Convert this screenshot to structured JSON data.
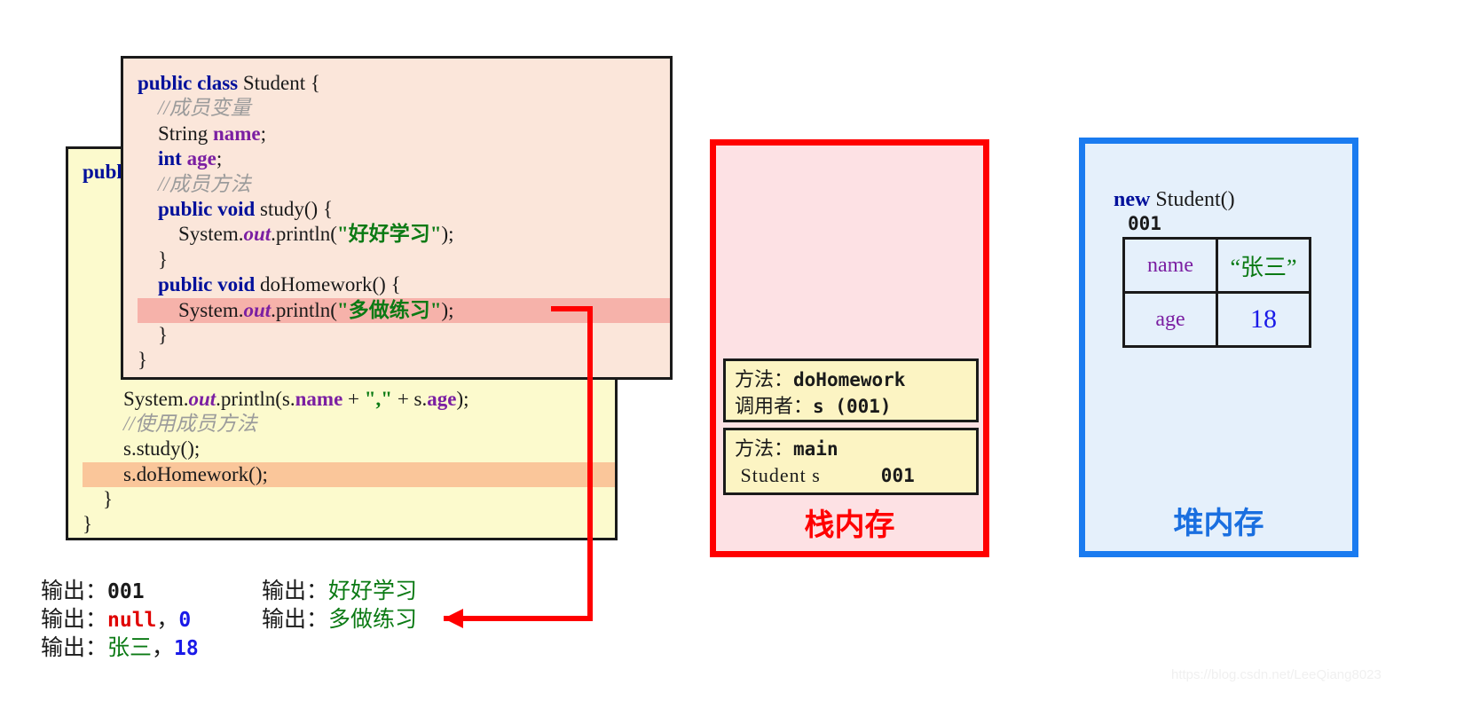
{
  "student_class": {
    "lines": [
      [
        {
          "t": "public ",
          "c": "kw"
        },
        {
          "t": "class ",
          "c": "kw"
        },
        {
          "t": "Student {",
          "c": ""
        }
      ],
      [
        {
          "t": "    //成员变量",
          "c": "cmt"
        }
      ],
      [
        {
          "t": "    String ",
          "c": ""
        },
        {
          "t": "name",
          "c": "field"
        },
        {
          "t": ";",
          "c": ""
        }
      ],
      [
        {
          "t": "    ",
          "c": ""
        },
        {
          "t": "int ",
          "c": "kw"
        },
        {
          "t": "age",
          "c": "field"
        },
        {
          "t": ";",
          "c": ""
        }
      ],
      [
        {
          "t": "    //成员方法",
          "c": "cmt"
        }
      ],
      [
        {
          "t": "    ",
          "c": ""
        },
        {
          "t": "public void ",
          "c": "kw"
        },
        {
          "t": "study() {",
          "c": ""
        }
      ],
      [
        {
          "t": "        System.",
          "c": ""
        },
        {
          "t": "out",
          "c": "outkw"
        },
        {
          "t": ".println(",
          "c": ""
        },
        {
          "t": "\"好好学习\"",
          "c": "str"
        },
        {
          "t": ");",
          "c": ""
        }
      ],
      [
        {
          "t": "    }",
          "c": ""
        }
      ],
      [
        {
          "t": "    ",
          "c": ""
        },
        {
          "t": "public void ",
          "c": "kw"
        },
        {
          "t": "doHomework() {",
          "c": ""
        }
      ],
      [
        {
          "t": "        System.",
          "c": ""
        },
        {
          "t": "out",
          "c": "outkw"
        },
        {
          "t": ".println(",
          "c": ""
        },
        {
          "t": "\"多做练习\"",
          "c": "str"
        },
        {
          "t": ");",
          "c": ""
        }
      ],
      [
        {
          "t": "    }",
          "c": ""
        }
      ],
      [
        {
          "t": "}",
          "c": ""
        }
      ]
    ],
    "highlight_line": 9
  },
  "test_class": {
    "lines": [
      [
        {
          "t": "publ",
          "c": "kw"
        }
      ],
      [
        {
          "t": "",
          "c": ""
        }
      ],
      [
        {
          "t": "",
          "c": ""
        }
      ],
      [
        {
          "t": "",
          "c": ""
        }
      ],
      [
        {
          "t": "",
          "c": ""
        }
      ],
      [
        {
          "t": "",
          "c": ""
        }
      ],
      [
        {
          "t": "",
          "c": ""
        }
      ],
      [
        {
          "t": "",
          "c": ""
        }
      ],
      [
        {
          "t": "",
          "c": ""
        }
      ],
      [
        {
          "t": "        System.",
          "c": ""
        },
        {
          "t": "out",
          "c": "outkw"
        },
        {
          "t": ".println(s.",
          "c": ""
        },
        {
          "t": "name",
          "c": "field"
        },
        {
          "t": " + ",
          "c": ""
        },
        {
          "t": "\",\"",
          "c": "str"
        },
        {
          "t": " + s.",
          "c": ""
        },
        {
          "t": "age",
          "c": "field"
        },
        {
          "t": ");",
          "c": ""
        }
      ],
      [
        {
          "t": "        //使用成员方法",
          "c": "cmt"
        }
      ],
      [
        {
          "t": "        s.study();",
          "c": ""
        }
      ],
      [
        {
          "t": "        s.doHomework();",
          "c": ""
        }
      ],
      [
        {
          "t": "    }",
          "c": ""
        }
      ],
      [
        {
          "t": "}",
          "c": ""
        }
      ]
    ],
    "highlight_line": 12
  },
  "stack": {
    "title": "栈内存",
    "frames": [
      {
        "name": "frame-dohomework",
        "rows": [
          {
            "label": "方法：",
            "value": "doHomework",
            "mono": true
          },
          {
            "label": "调用者：",
            "value": "s (001)",
            "mono": true
          }
        ]
      },
      {
        "name": "frame-main",
        "rows": [
          {
            "label": "方法：",
            "value": "main",
            "mono": true
          },
          {
            "label": " Student s",
            "value": "001",
            "mono": true
          }
        ]
      }
    ]
  },
  "heap": {
    "title": "堆内存",
    "new_keyword": "new",
    "new_call": " Student()",
    "address": "001",
    "object_fields": [
      {
        "key": "name",
        "value": "“张三”"
      },
      {
        "key": "age",
        "value": "18"
      }
    ]
  },
  "outputs": {
    "left": [
      {
        "label": "输出：",
        "value": "001",
        "value_color": "c-black",
        "mono": true
      },
      {
        "label": "输出：",
        "value": "null",
        "value_color": "c-red",
        "mono": true,
        "suffix": "，",
        "suffix2": "0",
        "suffix2_color": "c-blue"
      },
      {
        "label": "输出：",
        "value": "张三",
        "value_color": "c-green",
        "mono": false,
        "suffix": "，",
        "suffix2": "18",
        "suffix2_color": "c-blue"
      }
    ],
    "right": [
      {
        "label": "输出：",
        "value": "好好学习",
        "value_color": "c-green",
        "mono": false
      },
      {
        "label": "输出：",
        "value": "多做练习",
        "value_color": "c-green",
        "mono": false
      }
    ]
  },
  "colors": {
    "stack_border": "#ff0000",
    "stack_bg": "#fde1e4",
    "heap_border": "#1a7bf0",
    "heap_bg": "#e5f0fb",
    "student_bg": "#fbe6da",
    "test_bg": "#fcfacd",
    "arrow": "#ff0000"
  },
  "watermark": "https://blog.csdn.net/LeeQiang8023"
}
